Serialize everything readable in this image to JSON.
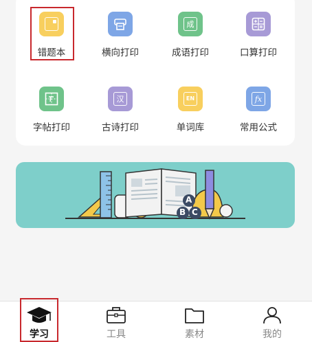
{
  "tools": [
    {
      "label": "错题本",
      "icon": "notebook-icon",
      "color": "#f8cf5e",
      "glyph": ""
    },
    {
      "label": "横向打印",
      "icon": "printer-icon",
      "color": "#7ea6e6",
      "glyph": ""
    },
    {
      "label": "成语打印",
      "icon": "idiom-icon",
      "color": "#6fc38a",
      "glyph": "成"
    },
    {
      "label": "口算打印",
      "icon": "calculator-icon",
      "color": "#a79ad6",
      "glyph": ""
    },
    {
      "label": "字帖打印",
      "icon": "copybook-icon",
      "color": "#6fc38a",
      "glyph": ""
    },
    {
      "label": "古诗打印",
      "icon": "poem-icon",
      "color": "#a79ad6",
      "glyph": "汉"
    },
    {
      "label": "单词库",
      "icon": "wordbank-icon",
      "color": "#f8cf5e",
      "glyph": "EN"
    },
    {
      "label": "常用公式",
      "icon": "formula-icon",
      "color": "#7ea6e6",
      "glyph": "fx"
    }
  ],
  "tabs": [
    {
      "label": "学习",
      "icon": "graduation-cap-icon",
      "active": true
    },
    {
      "label": "工具",
      "icon": "toolbox-icon",
      "active": false
    },
    {
      "label": "素材",
      "icon": "folder-icon",
      "active": false
    },
    {
      "label": "我的",
      "icon": "user-icon",
      "active": false
    }
  ],
  "colors": {
    "highlight": "#c8282d",
    "banner_bg": "#7ecfca"
  }
}
